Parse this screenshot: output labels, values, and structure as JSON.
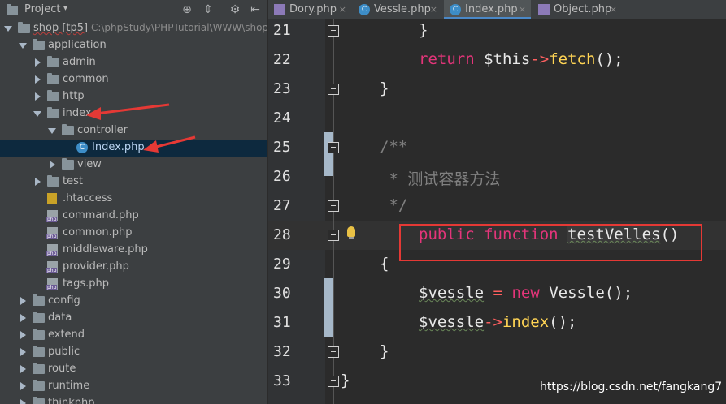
{
  "project_panel": {
    "title": "Project",
    "tree": [
      {
        "label": "shop [tp5]",
        "path": "C:\\phpStudy\\PHPTutorial\\WWW\\shop",
        "depth": 0,
        "expanded": true,
        "type": "folder"
      },
      {
        "label": "application",
        "depth": 1,
        "expanded": true,
        "type": "folder"
      },
      {
        "label": "admin",
        "depth": 2,
        "expanded": false,
        "type": "folder"
      },
      {
        "label": "common",
        "depth": 2,
        "expanded": false,
        "type": "folder"
      },
      {
        "label": "http",
        "depth": 2,
        "expanded": false,
        "type": "folder"
      },
      {
        "label": "index",
        "depth": 2,
        "expanded": true,
        "type": "folder"
      },
      {
        "label": "controller",
        "depth": 3,
        "expanded": true,
        "type": "folder"
      },
      {
        "label": "Index.php",
        "depth": 4,
        "type": "class",
        "selected": true
      },
      {
        "label": "view",
        "depth": 3,
        "expanded": false,
        "type": "folder"
      },
      {
        "label": "test",
        "depth": 2,
        "expanded": false,
        "type": "folder"
      },
      {
        "label": ".htaccess",
        "depth": 2,
        "type": "htaccess"
      },
      {
        "label": "command.php",
        "depth": 2,
        "type": "php"
      },
      {
        "label": "common.php",
        "depth": 2,
        "type": "php"
      },
      {
        "label": "middleware.php",
        "depth": 2,
        "type": "php"
      },
      {
        "label": "provider.php",
        "depth": 2,
        "type": "php"
      },
      {
        "label": "tags.php",
        "depth": 2,
        "type": "php"
      },
      {
        "label": "config",
        "depth": 1,
        "expanded": false,
        "type": "folder"
      },
      {
        "label": "data",
        "depth": 1,
        "expanded": false,
        "type": "folder"
      },
      {
        "label": "extend",
        "depth": 1,
        "expanded": false,
        "type": "folder"
      },
      {
        "label": "public",
        "depth": 1,
        "expanded": false,
        "type": "folder"
      },
      {
        "label": "route",
        "depth": 1,
        "expanded": false,
        "type": "folder"
      },
      {
        "label": "runtime",
        "depth": 1,
        "expanded": false,
        "type": "folder"
      },
      {
        "label": "thinkphp",
        "depth": 1,
        "expanded": false,
        "type": "folder"
      }
    ]
  },
  "tabs": [
    {
      "label": "Dory.php",
      "icon": "php-file-icon",
      "active": false
    },
    {
      "label": "Vessle.php",
      "icon": "class-icon",
      "active": false
    },
    {
      "label": "Index.php",
      "icon": "class-icon",
      "active": true
    },
    {
      "label": "Object.php",
      "icon": "php-file-icon",
      "active": false
    }
  ],
  "line_numbers": [
    "21",
    "22",
    "23",
    "24",
    "25",
    "26",
    "27",
    "28",
    "29",
    "30",
    "31",
    "32",
    "33"
  ],
  "code": {
    "l21": "}",
    "l22_kw": "return",
    "l22_this": "$this",
    "l22_arrow": "->",
    "l22_fn": "fetch",
    "l22_end": "();",
    "l23": "}",
    "l25": "/**",
    "l26": " * 测试容器方法",
    "l27": " */",
    "l28_public": "public",
    "l28_function": "function",
    "l28_name": "testVelles",
    "l28_parens": "()",
    "l29": "{",
    "l30_var": "$vessle",
    "l30_eq": "=",
    "l30_new": "new",
    "l30_class": "Vessle",
    "l30_end": "();",
    "l31_var": "$vessle",
    "l31_arrow": "->",
    "l31_fn": "index",
    "l31_end": "();",
    "l32": "}",
    "l33": "}"
  },
  "watermark": "https://blog.csdn.net/fangkang7",
  "colors": {
    "keyword": "#e4357a",
    "function": "#ffd454",
    "operator": "#fd5f5f",
    "comment": "#808080",
    "annotation_red": "#e53935",
    "selection": "#0d293e"
  }
}
